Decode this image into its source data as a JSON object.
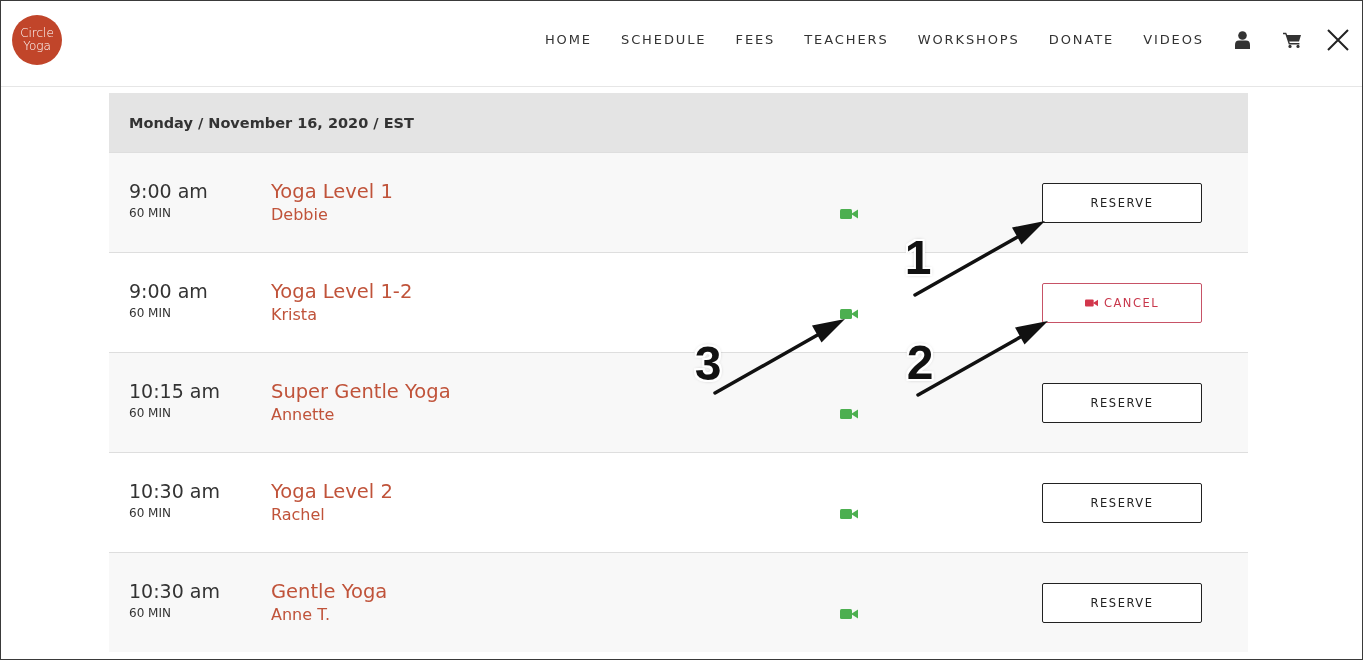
{
  "header": {
    "logo_text": "Circle Yoga",
    "nav": [
      {
        "label": "HOME"
      },
      {
        "label": "SCHEDULE"
      },
      {
        "label": "FEES"
      },
      {
        "label": "TEACHERS"
      },
      {
        "label": "WORKSHOPS"
      },
      {
        "label": "DONATE"
      },
      {
        "label": "VIDEOS"
      }
    ]
  },
  "schedule": {
    "date_heading": "Monday / November 16, 2020 / EST",
    "classes": [
      {
        "time": "9:00 am",
        "duration": "60 MIN",
        "name": "Yoga Level 1",
        "teacher": "Debbie",
        "online": true,
        "reserved": false,
        "button": "RESERVE"
      },
      {
        "time": "9:00 am",
        "duration": "60 MIN",
        "name": "Yoga Level 1-2",
        "teacher": "Krista",
        "online": true,
        "reserved": true,
        "button": "CANCEL"
      },
      {
        "time": "10:15 am",
        "duration": "60 MIN",
        "name": "Super Gentle Yoga",
        "teacher": "Annette",
        "online": true,
        "reserved": false,
        "button": "RESERVE"
      },
      {
        "time": "10:30 am",
        "duration": "60 MIN",
        "name": "Yoga Level 2",
        "teacher": "Rachel",
        "online": true,
        "reserved": false,
        "button": "RESERVE"
      },
      {
        "time": "10:30 am",
        "duration": "60 MIN",
        "name": "Gentle Yoga",
        "teacher": "Anne T.",
        "online": true,
        "reserved": false,
        "button": "RESERVE"
      }
    ]
  },
  "annotations": [
    {
      "label": "1"
    },
    {
      "label": "2"
    },
    {
      "label": "3"
    }
  ]
}
